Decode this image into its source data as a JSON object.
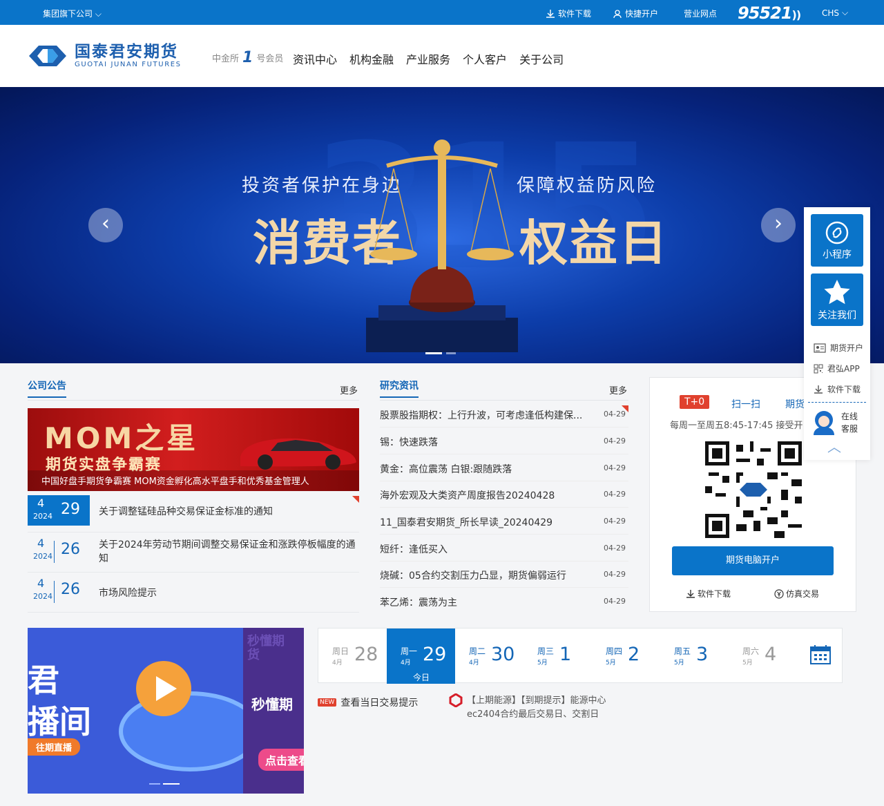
{
  "topbar": {
    "group": "集团旗下公司",
    "download": "软件下载",
    "open": "快捷开户",
    "branch": "营业网点",
    "hotline": "95521",
    "lang": "CHS"
  },
  "logo": {
    "cn": "国泰君安期货",
    "en": "GUOTAI JUNAN FUTURES"
  },
  "member": {
    "pre": "中金所",
    "num": "1",
    "post": "号会员"
  },
  "nav": [
    "资讯中心",
    "机构金融",
    "产业服务",
    "个人客户",
    "关于公司"
  ],
  "banner": {
    "left_small": "投资者保护在身边",
    "left_big": "消费者",
    "right_small": "保障权益防风险",
    "right_big": "权益日",
    "bg_text": "315"
  },
  "notice": {
    "title": "公司公告",
    "more": "更多",
    "promo": {
      "title": "MOM之星",
      "sub": "期货实盘争霸赛",
      "caption": "中国好盘手期货争霸赛 MOM资金孵化高水平盘手和优秀基金管理人"
    },
    "items": [
      {
        "month": "4",
        "year": "2024",
        "day": "29",
        "text": "关于调整锰硅品种交易保证金标准的通知"
      },
      {
        "month": "4",
        "year": "2024",
        "day": "26",
        "text": "关于2024年劳动节期间调整交易保证金和涨跌停板幅度的通知"
      },
      {
        "month": "4",
        "year": "2024",
        "day": "26",
        "text": "市场风险提示"
      }
    ]
  },
  "research": {
    "title": "研究资讯",
    "more": "更多",
    "items": [
      {
        "text": "股票股指期权：上行升波，可考虑逢低构建保...",
        "date": "04-29"
      },
      {
        "text": "锡：快速跌落",
        "date": "04-29"
      },
      {
        "text": "黄金：高位震荡 白银:跟随跌落",
        "date": "04-29"
      },
      {
        "text": "海外宏观及大类资产周度报告20240428",
        "date": "04-29"
      },
      {
        "text": "11_国泰君安期货_所长早读_20240429",
        "date": "04-29"
      },
      {
        "text": "短纤：逢低买入",
        "date": "04-29"
      },
      {
        "text": "烧碱：05合约交割压力凸显，期货偏弱运行",
        "date": "04-29"
      },
      {
        "text": "苯乙烯：震荡为主",
        "date": "04-29"
      }
    ]
  },
  "qr": {
    "tab_t0": "T+0",
    "tab_scan": "扫一扫",
    "tab_futures": "期货",
    "hours": "每周一至周五8:45-17:45 接受开",
    "btn": "期货电脑开户",
    "link_download": "软件下载",
    "link_sim": "仿真交易"
  },
  "live": {
    "t1": "君",
    "t2": "播间",
    "tag": "往期直播",
    "side1": "秒懂期",
    "side2": "点击查看",
    "side_badge": "秒懂期货"
  },
  "calendar": {
    "days": [
      {
        "wk": "周日",
        "mo": "4月",
        "day": "28",
        "state": "dim"
      },
      {
        "wk": "周一",
        "mo": "4月",
        "day": "29",
        "state": "today"
      },
      {
        "wk": "周二",
        "mo": "4月",
        "day": "30",
        "state": "normal"
      },
      {
        "wk": "周三",
        "mo": "5月",
        "day": "1",
        "state": "normal"
      },
      {
        "wk": "周四",
        "mo": "5月",
        "day": "2",
        "state": "normal"
      },
      {
        "wk": "周五",
        "mo": "5月",
        "day": "3",
        "state": "normal"
      },
      {
        "wk": "周六",
        "mo": "5月",
        "day": "4",
        "state": "dim"
      }
    ],
    "today_label": "今日",
    "new_badge": "NEW",
    "tip": "查看当日交易提示",
    "event_line1": "【上期能源】【到期提示】能源中心",
    "event_line2": "ec2404合约最后交易日、交割日"
  },
  "sidebar": {
    "mini": "小程序",
    "follow": "关注我们",
    "open": "期货开户",
    "app": "君弘APP",
    "download": "软件下载",
    "online1": "在线",
    "online2": "客服"
  },
  "colors": {
    "primary": "#0a74c9",
    "accent": "#e0412e"
  }
}
